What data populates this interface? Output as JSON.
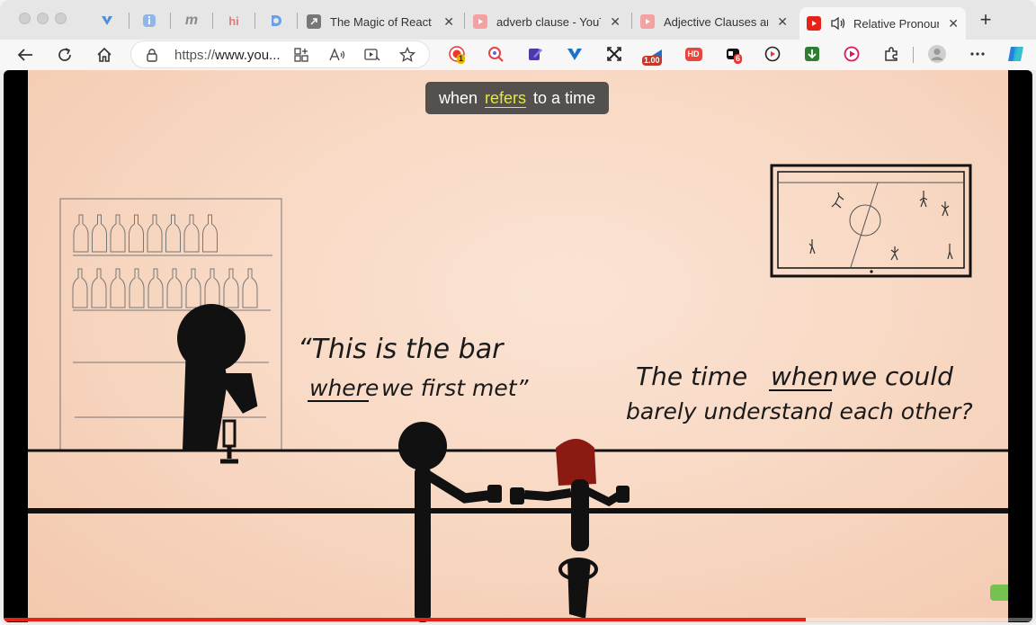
{
  "tabs": [
    {
      "title": "The Magic of React -",
      "icon": "external-link-icon",
      "active": false
    },
    {
      "title": "adverb clause - YouT",
      "icon": "youtube-icon",
      "active": false
    },
    {
      "title": "Adjective Clauses an",
      "icon": "youtube-icon",
      "active": false
    },
    {
      "title": "Relative Pronoun",
      "icon": "youtube-icon",
      "active": true,
      "audio": true
    }
  ],
  "pinned_tabs": [
    {
      "glyph": "v",
      "color": "#4a90d9"
    },
    {
      "glyph": "i",
      "color": "#6aa0e0"
    },
    {
      "glyph": "m",
      "color": "#888888"
    },
    {
      "glyph": "hi",
      "color": "#e37a7a"
    },
    {
      "glyph": "d",
      "color": "#5b8fe0"
    }
  ],
  "address_bar": {
    "scheme": "https://",
    "host": "www.you..."
  },
  "extension_badges": {
    "rec_count": "1",
    "speed": "1.00",
    "hd": "HD",
    "notif_count": "6"
  },
  "video": {
    "caption_before": "when",
    "caption_highlight": "refers",
    "caption_after": "to a time",
    "quote_line1": "“This is the bar",
    "quote_line2_u": "where",
    "quote_line2_rest": "we first met”",
    "question_line1_a": "The time",
    "question_line1_u": "when",
    "question_line1_b": "we could",
    "question_line2": "barely understand each other?",
    "progress_fraction": 0.78
  },
  "colors": {
    "youtube_red": "#e62117",
    "caption_highlight": "#e4ea2c",
    "edge_blue": "#2a7de1"
  }
}
